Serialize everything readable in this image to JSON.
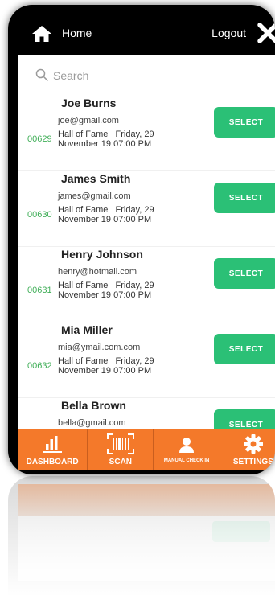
{
  "header": {
    "home_label": "Home",
    "logout_label": "Logout",
    "home_icon": "home-icon",
    "close_icon": "close-icon"
  },
  "search": {
    "placeholder": "Search",
    "value": "",
    "icon": "search-icon"
  },
  "attendees": [
    {
      "name": "Joe Burns",
      "email": "joe@gmail.com",
      "id": "00629",
      "event_line1": "Hall of Fame   Friday, 29",
      "event_line2": "November 19 07:00 PM",
      "select_label": "SELECT"
    },
    {
      "name": "James Smith",
      "email": "james@gmail.com",
      "id": "00630",
      "event_line1": "Hall of Fame   Friday, 29",
      "event_line2": "November 19 07:00 PM",
      "select_label": "SELECT"
    },
    {
      "name": "Henry Johnson",
      "email": "henry@hotmail.com",
      "id": "00631",
      "event_line1": "Hall of Fame   Friday, 29",
      "event_line2": "November 19 07:00 PM",
      "select_label": "SELECT"
    },
    {
      "name": "Mia Miller",
      "email": "mia@ymail.com.com",
      "id": "00632",
      "event_line1": "Hall of Fame   Friday, 29",
      "event_line2": "November 19 07:00 PM",
      "select_label": "SELECT"
    },
    {
      "name": "Bella Brown",
      "email": "bella@gmail.com",
      "id": "",
      "event_line1": "",
      "event_line2": "",
      "select_label": "SELECT"
    }
  ],
  "tabs": [
    {
      "label": "DASHBOARD",
      "icon": "bar-chart-icon"
    },
    {
      "label": "SCAN",
      "icon": "barcode-scan-icon"
    },
    {
      "label": "MANUAL CHECK IN",
      "icon": "person-icon"
    },
    {
      "label": "SETTINGS",
      "icon": "gear-icon"
    }
  ],
  "colors": {
    "header_bg": "#000000",
    "accent_orange": "#f4792a",
    "select_green": "#2bc076",
    "id_green": "#3fae57"
  }
}
